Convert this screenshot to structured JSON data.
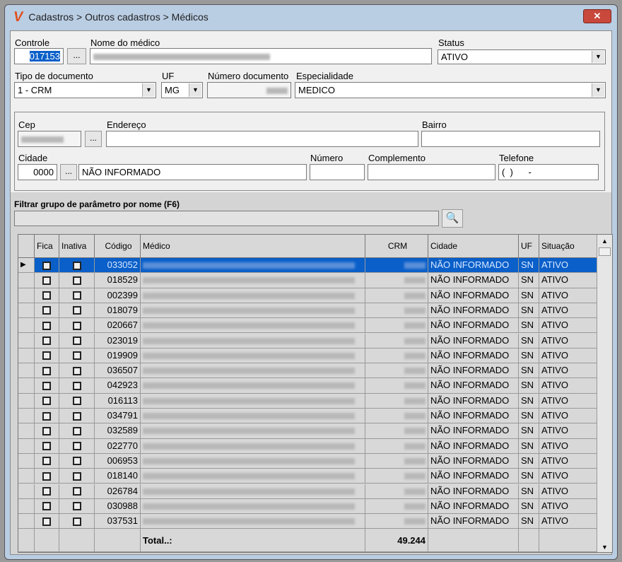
{
  "window": {
    "title": "Cadastros > Outros cadastros > Médicos",
    "logo": "V",
    "close": "✕"
  },
  "form": {
    "controle_label": "Controle",
    "controle_value": "017153",
    "lookup": "...",
    "nome_label": "Nome do médico",
    "status_label": "Status",
    "status_value": "ATIVO",
    "tipo_label": "Tipo de documento",
    "tipo_value": "1 - CRM",
    "uf_label": "UF",
    "uf_value": "MG",
    "numero_doc_label": "Número documento",
    "especialidade_label": "Especialidade",
    "especialidade_value": "MEDICO"
  },
  "address": {
    "cep_label": "Cep",
    "endereco_label": "Endereço",
    "bairro_label": "Bairro",
    "cidade_label": "Cidade",
    "cidade_code": "0000",
    "cidade_value": "NÃO INFORMADO",
    "numero_label": "Número",
    "complemento_label": "Complemento",
    "telefone_label": "Telefone",
    "telefone_value": "(  )      -"
  },
  "filter": {
    "label": "Filtrar grupo de parâmetro por nome (F6)",
    "value": "",
    "search_icon": "search-icon"
  },
  "grid": {
    "columns": [
      "Fica",
      "Inativa",
      "Código",
      "Médico",
      "CRM",
      "Cidade",
      "UF",
      "Situação"
    ],
    "rows": [
      {
        "codigo": "033052",
        "cidade": "NÃO INFORMADO",
        "uf": "SN",
        "situacao": "ATIVO",
        "selected": true
      },
      {
        "codigo": "018529",
        "cidade": "NÃO INFORMADO",
        "uf": "SN",
        "situacao": "ATIVO"
      },
      {
        "codigo": "002399",
        "cidade": "NÃO INFORMADO",
        "uf": "SN",
        "situacao": "ATIVO"
      },
      {
        "codigo": "018079",
        "cidade": "NÃO INFORMADO",
        "uf": "SN",
        "situacao": "ATIVO"
      },
      {
        "codigo": "020667",
        "cidade": "NÃO INFORMADO",
        "uf": "SN",
        "situacao": "ATIVO"
      },
      {
        "codigo": "023019",
        "cidade": "NÃO INFORMADO",
        "uf": "SN",
        "situacao": "ATIVO"
      },
      {
        "codigo": "019909",
        "cidade": "NÃO INFORMADO",
        "uf": "SN",
        "situacao": "ATIVO"
      },
      {
        "codigo": "036507",
        "cidade": "NÃO INFORMADO",
        "uf": "SN",
        "situacao": "ATIVO"
      },
      {
        "codigo": "042923",
        "cidade": "NÃO INFORMADO",
        "uf": "SN",
        "situacao": "ATIVO"
      },
      {
        "codigo": "016113",
        "cidade": "NÃO INFORMADO",
        "uf": "SN",
        "situacao": "ATIVO"
      },
      {
        "codigo": "034791",
        "cidade": "NÃO INFORMADO",
        "uf": "SN",
        "situacao": "ATIVO"
      },
      {
        "codigo": "032589",
        "cidade": "NÃO INFORMADO",
        "uf": "SN",
        "situacao": "ATIVO"
      },
      {
        "codigo": "022770",
        "cidade": "NÃO INFORMADO",
        "uf": "SN",
        "situacao": "ATIVO"
      },
      {
        "codigo": "006953",
        "cidade": "NÃO INFORMADO",
        "uf": "SN",
        "situacao": "ATIVO"
      },
      {
        "codigo": "018140",
        "cidade": "NÃO INFORMADO",
        "uf": "SN",
        "situacao": "ATIVO"
      },
      {
        "codigo": "026784",
        "cidade": "NÃO INFORMADO",
        "uf": "SN",
        "situacao": "ATIVO"
      },
      {
        "codigo": "030988",
        "cidade": "NÃO INFORMADO",
        "uf": "SN",
        "situacao": "ATIVO"
      },
      {
        "codigo": "037531",
        "cidade": "NÃO INFORMADO",
        "uf": "SN",
        "situacao": "ATIVO"
      }
    ],
    "total_label": "Total..:",
    "total_value": "49.244"
  },
  "colors": {
    "selection": "#0a5fc9",
    "title_bar": "#b9cde3",
    "close": "#c9483c"
  }
}
